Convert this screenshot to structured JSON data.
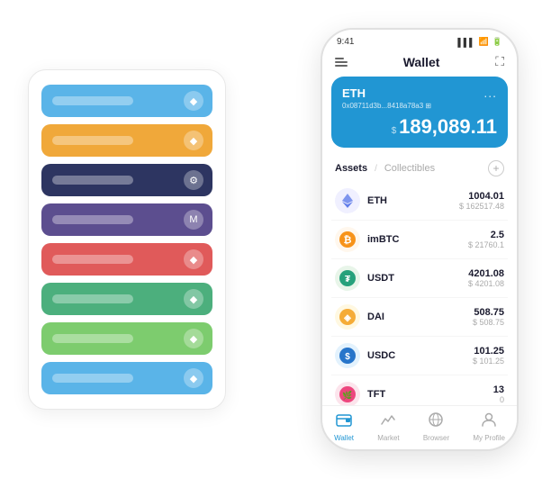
{
  "scene": {
    "background": "#ffffff"
  },
  "cardStack": {
    "cards": [
      {
        "id": "card-blue",
        "color": "#5ab4e8",
        "iconText": "◆"
      },
      {
        "id": "card-orange",
        "color": "#f0a83a",
        "iconText": "◆"
      },
      {
        "id": "card-dark",
        "color": "#2d3561",
        "iconText": "⚙"
      },
      {
        "id": "card-purple",
        "color": "#5c4e8f",
        "iconText": "M"
      },
      {
        "id": "card-red",
        "color": "#e05a5a",
        "iconText": "◆"
      },
      {
        "id": "card-green",
        "color": "#4caf7d",
        "iconText": "◆"
      },
      {
        "id": "card-lightgreen",
        "color": "#7dcc6e",
        "iconText": "◆"
      },
      {
        "id": "card-lightblue",
        "color": "#5ab4e8",
        "iconText": "◆"
      }
    ]
  },
  "phone": {
    "statusBar": {
      "time": "9:41",
      "signal": "▌▌▌",
      "wifi": "WiFi",
      "battery": "🔋"
    },
    "header": {
      "title": "Wallet",
      "menuIcon": "menu",
      "scanIcon": "scan"
    },
    "ethCard": {
      "title": "ETH",
      "address": "0x08711d3b...8418a78a3",
      "addressSuffix": "⊞",
      "dotsLabel": "...",
      "balancePrefix": "$",
      "balance": "189,089.11",
      "color": "#2196d3"
    },
    "assets": {
      "activeTab": "Assets",
      "inactiveTab": "Collectibles",
      "divider": "/",
      "rows": [
        {
          "symbol": "ETH",
          "iconEmoji": "◈",
          "iconBg": "#f5f5f5",
          "iconColor": "#627eea",
          "amount": "1004.01",
          "usdValue": "$ 162517.48"
        },
        {
          "symbol": "imBTC",
          "iconEmoji": "🔵",
          "iconBg": "#f0f0f0",
          "iconColor": "#f7931a",
          "amount": "2.5",
          "usdValue": "$ 21760.1"
        },
        {
          "symbol": "USDT",
          "iconEmoji": "Ⓣ",
          "iconBg": "#e8f5e9",
          "iconColor": "#26a17b",
          "amount": "4201.08",
          "usdValue": "$ 4201.08"
        },
        {
          "symbol": "DAI",
          "iconEmoji": "◉",
          "iconBg": "#fff8e1",
          "iconColor": "#f5ac37",
          "amount": "508.75",
          "usdValue": "$ 508.75"
        },
        {
          "symbol": "USDC",
          "iconEmoji": "$",
          "iconBg": "#e3f2fd",
          "iconColor": "#2775ca",
          "amount": "101.25",
          "usdValue": "$ 101.25"
        },
        {
          "symbol": "TFT",
          "iconEmoji": "🌿",
          "iconBg": "#fce4ec",
          "iconColor": "#e91e63",
          "amount": "13",
          "usdValue": "0"
        }
      ]
    },
    "bottomNav": [
      {
        "id": "wallet",
        "label": "Wallet",
        "icon": "💼",
        "active": true
      },
      {
        "id": "market",
        "label": "Market",
        "icon": "📈",
        "active": false
      },
      {
        "id": "browser",
        "label": "Browser",
        "icon": "🌐",
        "active": false
      },
      {
        "id": "profile",
        "label": "My Profile",
        "icon": "👤",
        "active": false
      }
    ]
  }
}
